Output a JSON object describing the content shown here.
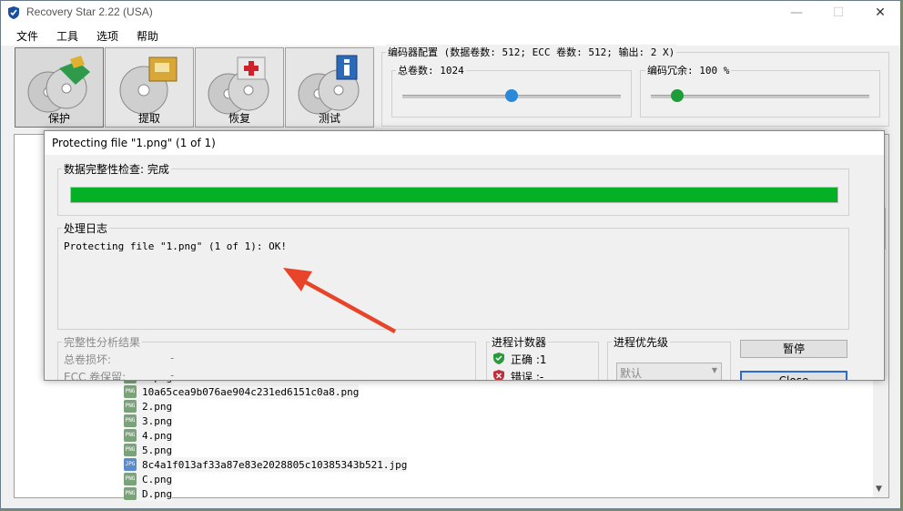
{
  "window": {
    "title": "Recovery Star 2.22 (USA)",
    "minimize": "—",
    "maximize": "☐",
    "close": "✕"
  },
  "menu": [
    "文件",
    "工具",
    "选项",
    "帮助"
  ],
  "toolbar": [
    {
      "label": "保护",
      "icon": "protect-icon"
    },
    {
      "label": "提取",
      "icon": "extract-icon"
    },
    {
      "label": "恢复",
      "icon": "recover-icon"
    },
    {
      "label": "测试",
      "icon": "test-icon"
    }
  ],
  "encoder": {
    "title": "编码器配置 (数据卷数: 512; ECC 卷数: 512; 输出: 2 X)",
    "total_label": "总卷数: 1024",
    "redundancy_label": "编码冗余: 100 %",
    "total_slider_value": 0.5,
    "redundancy_slider_value": 0.12,
    "colors": {
      "total_thumb": "#2a8ad8",
      "redundancy_thumb": "#1f9c3a"
    }
  },
  "files": [
    {
      "name": "1.png",
      "type": "png"
    },
    {
      "name": "10a65cea9b076ae904c231ed6151c0a8.png",
      "type": "png"
    },
    {
      "name": "2.png",
      "type": "png"
    },
    {
      "name": "3.png",
      "type": "png"
    },
    {
      "name": "4.png",
      "type": "png"
    },
    {
      "name": "5.png",
      "type": "png"
    },
    {
      "name": "8c4a1f013af33a87e83e2028805c10385343b521.jpg",
      "type": "jpg"
    },
    {
      "name": "C.png",
      "type": "png"
    },
    {
      "name": "D.png",
      "type": "png"
    }
  ],
  "dialog": {
    "title": "Protecting file \"1.png\" (1 of 1)",
    "integrity_title": "数据完整性检查: 完成",
    "progress": 1.0,
    "progress_color": "#06b025",
    "log_title": "处理日志",
    "log_text": "Protecting file \"1.png\" (1 of 1): OK!",
    "analysis": {
      "title": "完整性分析结果",
      "rows": [
        {
          "label": "总卷损坏:",
          "value": "-"
        },
        {
          "label": "ECC 卷保留:",
          "value": "-"
        }
      ]
    },
    "counter": {
      "title": "进程计数器",
      "ok_label": "正确 :1",
      "err_label": "错误 :-"
    },
    "priority": {
      "title": "进程优先级",
      "selected": "默认"
    },
    "pause_button": "暂停",
    "close_button": "Close",
    "annotation_color": "#e8442a"
  }
}
